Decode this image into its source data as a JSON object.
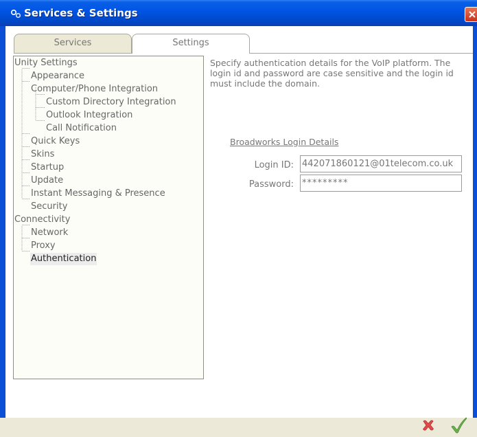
{
  "window": {
    "title": "Services & Settings",
    "icon": "gears-icon",
    "close_icon": "close-icon"
  },
  "tabs": [
    {
      "label": "Services",
      "active": false
    },
    {
      "label": "Settings",
      "active": true
    }
  ],
  "tree": {
    "items": [
      {
        "label": "Unity Settings"
      },
      {
        "label": "Appearance"
      },
      {
        "label": "Computer/Phone Integration"
      },
      {
        "label": "Custom Directory Integration"
      },
      {
        "label": "Outlook Integration"
      },
      {
        "label": "Call Notification"
      },
      {
        "label": "Quick Keys"
      },
      {
        "label": "Skins"
      },
      {
        "label": "Startup"
      },
      {
        "label": "Update"
      },
      {
        "label": "Instant Messaging & Presence"
      },
      {
        "label": "Security"
      },
      {
        "label": "Connectivity"
      },
      {
        "label": "Network"
      },
      {
        "label": "Proxy"
      },
      {
        "label": "Authentication",
        "selected": true
      }
    ]
  },
  "details": {
    "description": "Specify authentication details for the VoIP platform.  The login id and password are case sensitive and the login id must include the domain.",
    "section_title": "Broadworks Login Details",
    "login_label": "Login ID:",
    "login_value": "442071860121@01telecom.co.uk",
    "password_label": "Password:",
    "password_value": "*********"
  },
  "buttons": {
    "cancel_icon": "red-x-cancel-icon",
    "ok_icon": "green-checkmark-icon"
  },
  "colors": {
    "titlebar": "#0055e5",
    "cancel": "#e04a4a",
    "ok": "#6ab04c"
  }
}
